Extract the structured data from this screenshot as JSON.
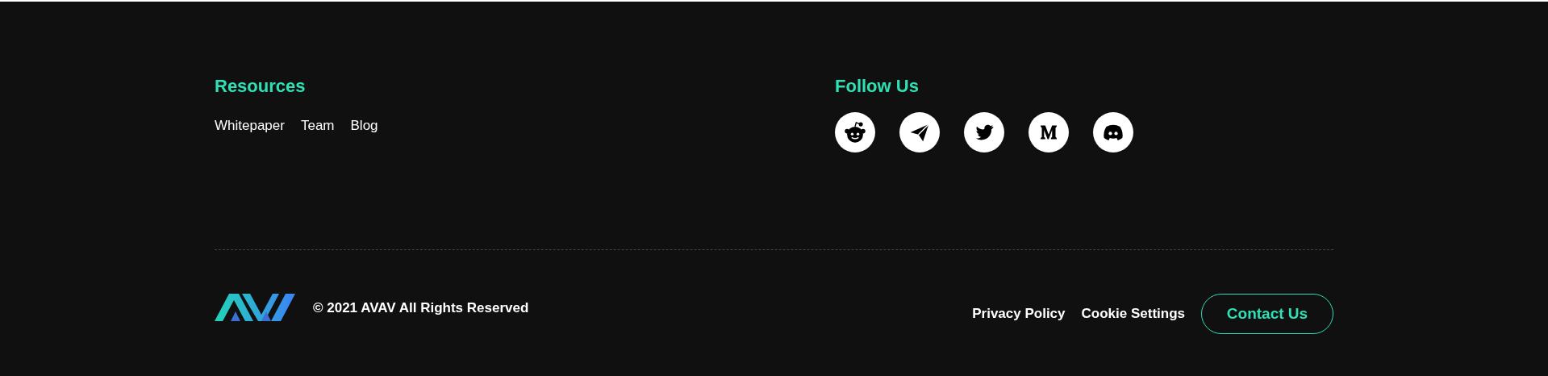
{
  "resources": {
    "title": "Resources",
    "links": [
      "Whitepaper",
      "Team",
      "Blog"
    ]
  },
  "follow": {
    "title": "Follow Us",
    "icons": [
      {
        "kind": "reddit"
      },
      {
        "kind": "telegram"
      },
      {
        "kind": "twitter"
      },
      {
        "kind": "medium"
      },
      {
        "kind": "discord"
      }
    ]
  },
  "bottom": {
    "copyright": "© 2021 AVAV All Rights Reserved",
    "links": [
      "Privacy Policy",
      "Cookie Settings"
    ],
    "button": "Contact Us"
  }
}
